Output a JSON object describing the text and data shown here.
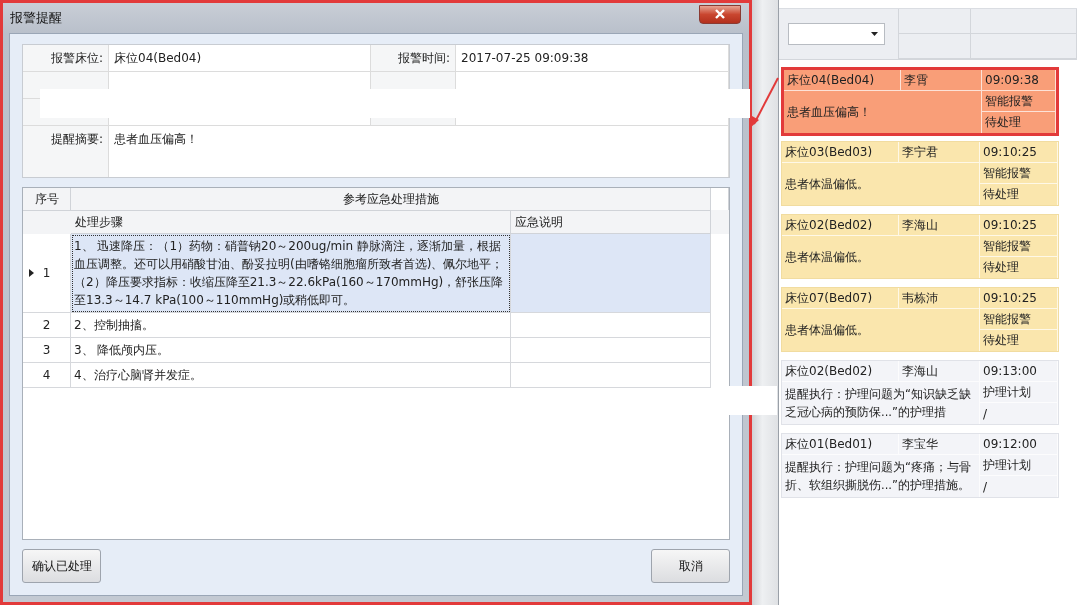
{
  "dialog": {
    "title": "报警提醒",
    "fields": [
      {
        "label": "报警床位:",
        "value": "床位04(Bed04)"
      },
      {
        "label": "报警时间:",
        "value": "2017-07-25 09:09:38"
      }
    ],
    "summary": {
      "label": "提醒摘要:",
      "value": "患者血压偏高！"
    },
    "table": {
      "columns": {
        "number": "序号",
        "group": "参考应急处理措施",
        "step": "处理步骤",
        "note": "应急说明"
      },
      "rows": [
        {
          "number": "1",
          "step": "1、 迅速降压：（1）药物：硝普钠20～200ug/min 静脉滴注，逐渐加量，根据血压调整。还可以用硝酸甘油、酚妥拉明(由嗜铬细胞瘤所致者首选)、佩尔地平；（2）降压要求指标：收缩压降至21.3～22.6kPa(160～170mmHg)，舒张压降至13.3～14.7 kPa(100～110mmHg)或稍低即可。",
          "selected": true
        },
        {
          "number": "2",
          "step": "2、控制抽搐。",
          "selected": false
        },
        {
          "number": "3",
          "step": "3、 降低颅内压。",
          "selected": false
        },
        {
          "number": "4",
          "step": "4、治疗心脑肾并发症。",
          "selected": false
        }
      ]
    },
    "buttons": [
      {
        "label": "确认已处理"
      },
      {
        "label": "取消"
      }
    ]
  },
  "alerts": [
    {
      "kind": "alarm",
      "selected": true,
      "bed": "床位04(Bed04)",
      "name": "李霄",
      "time": "09:09:38",
      "message": "患者血压偏高！",
      "type": "智能报警",
      "status": "待处理"
    },
    {
      "kind": "alarm",
      "selected": false,
      "bed": "床位03(Bed03)",
      "name": "李宁君",
      "time": "09:10:25",
      "message": "患者体温偏低。",
      "type": "智能报警",
      "status": "待处理"
    },
    {
      "kind": "alarm",
      "selected": false,
      "bed": "床位02(Bed02)",
      "name": "李海山",
      "time": "09:10:25",
      "message": "患者体温偏低。",
      "type": "智能报警",
      "status": "待处理"
    },
    {
      "kind": "alarm",
      "selected": false,
      "bed": "床位07(Bed07)",
      "name": "韦栋沛",
      "time": "09:10:25",
      "message": "患者体温偏低。",
      "type": "智能报警",
      "status": "待处理"
    },
    {
      "kind": "plan",
      "selected": false,
      "bed": "床位02(Bed02)",
      "name": "李海山",
      "time": "09:13:00",
      "message": "提醒执行：护理问题为“知识缺乏缺乏冠心病的预防保...”的护理措",
      "type": "护理计划",
      "status": "/"
    },
    {
      "kind": "plan",
      "selected": false,
      "bed": "床位01(Bed01)",
      "name": "李宝华",
      "time": "09:12:00",
      "message": "提醒执行：护理问题为“疼痛；与骨折、软组织撕脱伤...”的护理措施。",
      "type": "护理计划",
      "status": "/"
    }
  ]
}
